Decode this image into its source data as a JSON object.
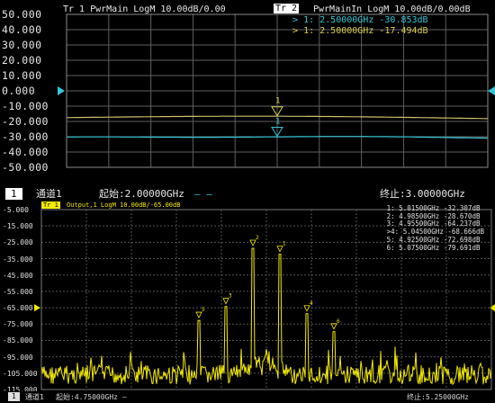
{
  "top_panel": {
    "y_ticks": [
      "50.000",
      "40.000",
      "30.000",
      "20.000",
      "10.000",
      "0.000",
      "-10.000",
      "-20.000",
      "-30.000",
      "-40.000",
      "-50.000"
    ],
    "trace1_header": "Tr 1  PwrMain LogM 10.00dB/0.00",
    "trace2_badge": "Tr 2",
    "trace2_header": "PwrMainIn LogM 10.00dB/0.00dB",
    "marker1": {
      "prefix": ">",
      "label": "1:",
      "freq": "2.50000GHz",
      "value": "-30.853dB"
    },
    "marker2": {
      "prefix": ">",
      "label": "1:",
      "freq": "2.50000GHz",
      "value": "-17.494dB"
    },
    "marker_flag": "1",
    "channel_box": "1",
    "channel_label": "通道1",
    "start_label": "起始:2.00000GHz",
    "legend_dash": "— —",
    "stop_label": "终止:3.00000GHz",
    "colors": {
      "trace1": "#c9c069",
      "trace2": "#37c6d8",
      "grid": "#5f5f5f",
      "marker_arrow": "#37c6d8"
    }
  },
  "bottom_panel": {
    "y_ticks": [
      "-5.000",
      "-15.000",
      "-25.000",
      "-35.000",
      "-45.000",
      "-55.000",
      "-65.000",
      "-75.000",
      "-85.000",
      "-95.000",
      "-105.000",
      "-115.000"
    ],
    "trace_badge": "Tr 1",
    "trace_header": "Output,1 LogM 10.00dB/-65.00dB",
    "markers": [
      {
        "label": "1:",
        "freq": "5.01500GHz",
        "value": "-32.307dB"
      },
      {
        "label": "2:",
        "freq": "4.98500GHz",
        "value": "-28.670dB"
      },
      {
        "label": "3:",
        "freq": "4.95500GHz",
        "value": "-64.237dB"
      },
      {
        "label": ">4:",
        "freq": "5.04500GHz",
        "value": "-68.666dB"
      },
      {
        "label": "5:",
        "freq": "4.92500GHz",
        "value": "-72.698dB"
      },
      {
        "label": "6:",
        "freq": "5.07500GHz",
        "value": "-79.691dB"
      }
    ],
    "channel_box": "1",
    "channel_label": "通道1",
    "start_label": "起始:4.75000GHz",
    "legend_dash": "—",
    "stop_label": "终止:5.25000GHz",
    "colors": {
      "trace": "#f3ea00",
      "grid": "#555555"
    }
  }
}
